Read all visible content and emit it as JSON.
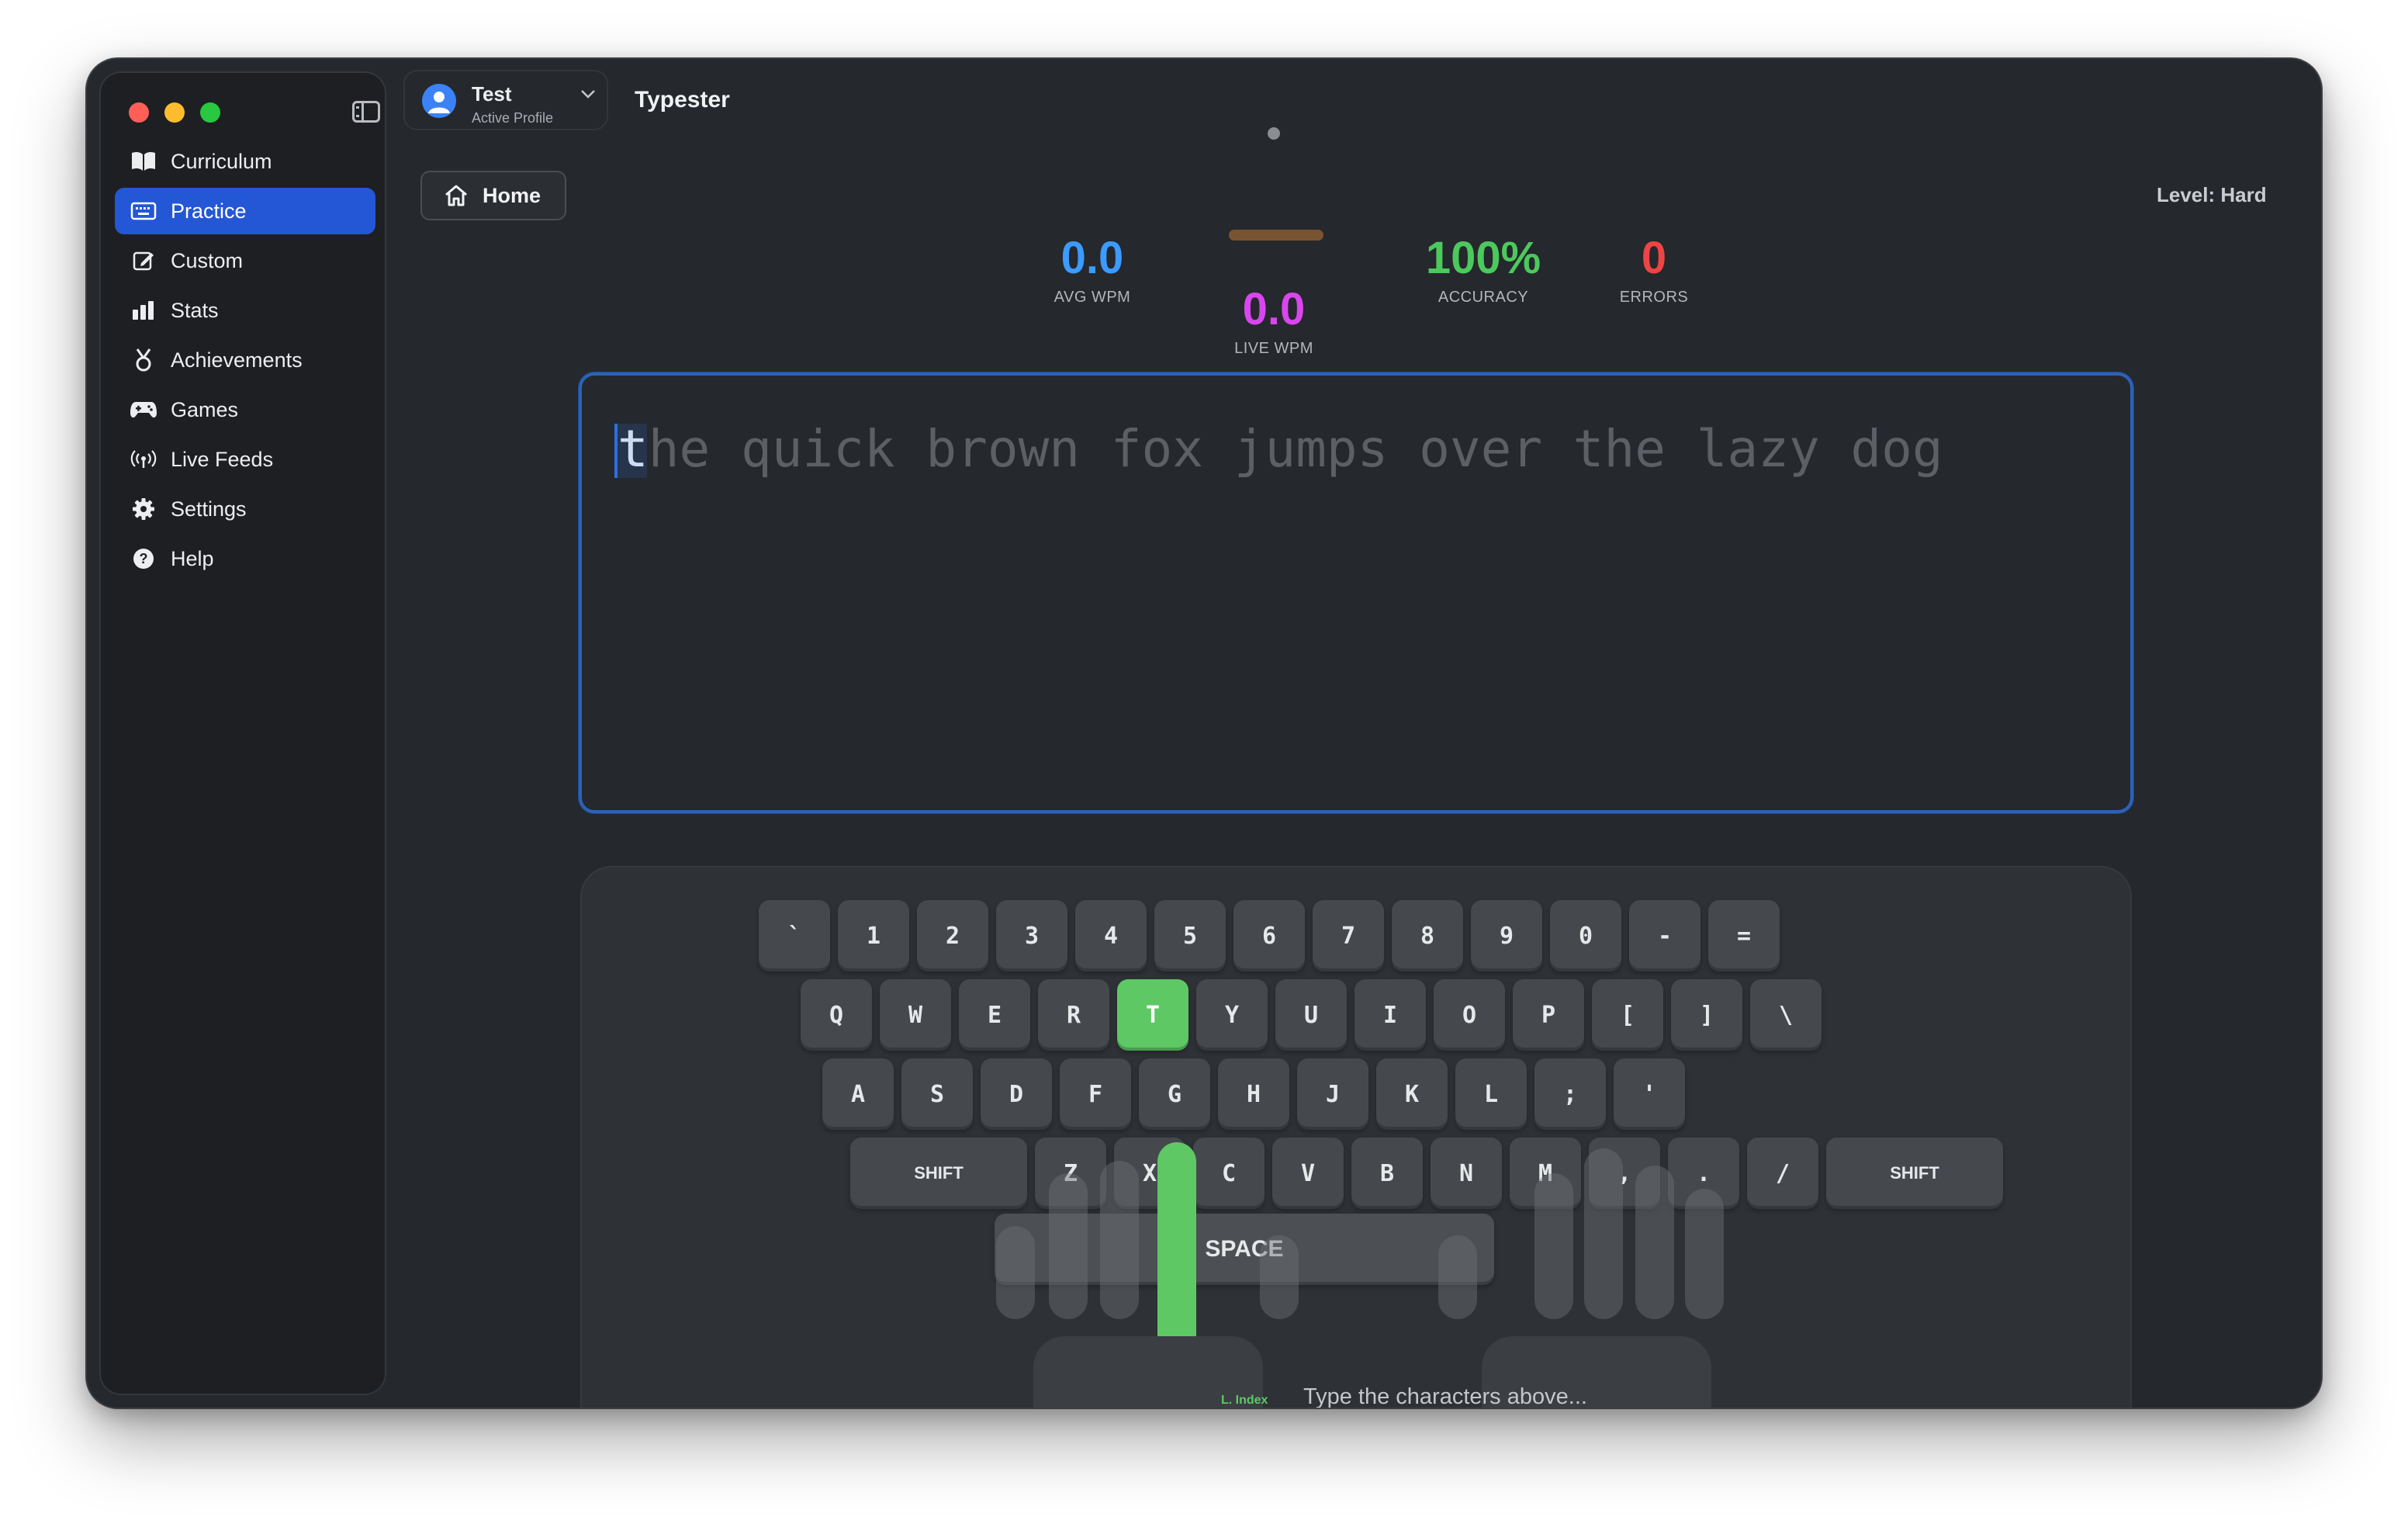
{
  "window": {
    "traffic_lights": [
      "close",
      "minimize",
      "zoom"
    ]
  },
  "sidebar": {
    "items": [
      {
        "label": "Curriculum",
        "icon": "book-icon",
        "active": false
      },
      {
        "label": "Practice",
        "icon": "keyboard-icon",
        "active": true
      },
      {
        "label": "Custom",
        "icon": "edit-icon",
        "active": false
      },
      {
        "label": "Stats",
        "icon": "bar-chart-icon",
        "active": false
      },
      {
        "label": "Achievements",
        "icon": "medal-icon",
        "active": false
      },
      {
        "label": "Games",
        "icon": "gamepad-icon",
        "active": false
      },
      {
        "label": "Live Feeds",
        "icon": "broadcast-icon",
        "active": false
      },
      {
        "label": "Settings",
        "icon": "gear-icon",
        "active": false
      },
      {
        "label": "Help",
        "icon": "help-icon",
        "active": false
      }
    ]
  },
  "profile": {
    "name": "Test",
    "subtitle": "Active Profile"
  },
  "app": {
    "title": "Typester"
  },
  "toolbar": {
    "home_label": "Home",
    "level_text": "Level: Hard"
  },
  "stats": {
    "avg_wpm": {
      "value": "0.0",
      "label": "AVG WPM",
      "color": "#3b9bff"
    },
    "live_wpm": {
      "value": "0.0",
      "label": "LIVE WPM",
      "color": "#d946ef"
    },
    "accuracy": {
      "value": "100%",
      "label": "ACCURACY",
      "color": "#4cc95d"
    },
    "errors": {
      "value": "0",
      "label": "ERRORS",
      "color": "#ef4444"
    }
  },
  "practice": {
    "current_char": "t",
    "remaining_text": "he quick brown fox jumps over the lazy dog"
  },
  "keyboard": {
    "rows": [
      [
        "`",
        "1",
        "2",
        "3",
        "4",
        "5",
        "6",
        "7",
        "8",
        "9",
        "0",
        "-",
        "="
      ],
      [
        "Q",
        "W",
        "E",
        "R",
        "T",
        "Y",
        "U",
        "I",
        "O",
        "P",
        "[",
        "]",
        "\\"
      ],
      [
        "A",
        "S",
        "D",
        "F",
        "G",
        "H",
        "J",
        "K",
        "L",
        ";",
        "'"
      ],
      [
        "SHIFT",
        "Z",
        "X",
        "C",
        "V",
        "B",
        "N",
        "M",
        ",",
        ".",
        "/",
        "SHIFT"
      ]
    ],
    "space_label": "SPACE",
    "highlighted_key": "T",
    "highlight_color": "#5ec864",
    "finger_label": "L. Index",
    "hint": "Type the characters above..."
  }
}
